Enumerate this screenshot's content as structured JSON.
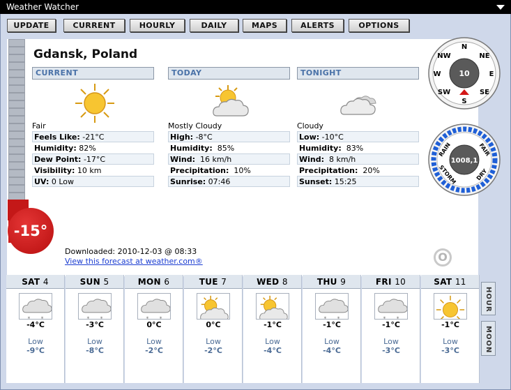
{
  "window": {
    "title": "Weather Watcher"
  },
  "toolbar": [
    {
      "id": "update",
      "label": "UPDATE"
    },
    {
      "id": "current",
      "label": "CURRENT"
    },
    {
      "id": "hourly",
      "label": "HOURLY"
    },
    {
      "id": "daily",
      "label": "DAILY"
    },
    {
      "id": "maps",
      "label": "MAPS"
    },
    {
      "id": "alerts",
      "label": "ALERTS"
    },
    {
      "id": "options",
      "label": "OPTIONS"
    }
  ],
  "location": "Gdansk, Poland",
  "current_temp": "-15°",
  "current": {
    "header": "CURRENT",
    "icon": "sun-icon",
    "condition": "Fair",
    "rows": [
      {
        "label": "Feels Like:",
        "value": " -21°C",
        "shaded": true
      },
      {
        "label": "Humidity:",
        "value": " 82%",
        "shaded": false
      },
      {
        "label": "Dew Point:",
        "value": " -17°C",
        "shaded": true
      },
      {
        "label": "Visibility:",
        "value": " 10 km",
        "shaded": false
      },
      {
        "label": "UV:",
        "value": " 0 Low",
        "shaded": true
      }
    ]
  },
  "today": {
    "header": "TODAY",
    "icon": "mostly-cloudy-icon",
    "condition": "Mostly Cloudy",
    "rows": [
      {
        "label": "High:",
        "value": " -8°C",
        "shaded": true
      },
      {
        "label": "Humidity:",
        "value": "  85%",
        "shaded": false
      },
      {
        "label": "Wind:",
        "value": "  16 km/h",
        "shaded": true
      },
      {
        "label": "Precipitation:",
        "value": "  10%",
        "shaded": false
      },
      {
        "label": "Sunrise:",
        "value": " 07:46",
        "shaded": true
      }
    ]
  },
  "tonight": {
    "header": "TONIGHT",
    "icon": "cloudy-icon",
    "condition": "Cloudy",
    "rows": [
      {
        "label": "Low:",
        "value": " -10°C",
        "shaded": true
      },
      {
        "label": "Humidity:",
        "value": "  83%",
        "shaded": false
      },
      {
        "label": "Wind:",
        "value": "  8 km/h",
        "shaded": true
      },
      {
        "label": "Precipitation:",
        "value": "  20%",
        "shaded": false
      },
      {
        "label": "Sunset:",
        "value": " 15:25",
        "shaded": true
      }
    ]
  },
  "downloaded": "Downloaded: 2010-12-03 @ 08:33",
  "forecast_link": "View this forecast at weather.com®",
  "compass": {
    "speed": "10",
    "labels": {
      "n": "N",
      "ne": "NE",
      "e": "E",
      "se": "SE",
      "s": "S",
      "sw": "SW",
      "w": "W",
      "nw": "NW"
    },
    "direction": "S"
  },
  "barometer": {
    "value": "1008,1",
    "labels": {
      "rain": "RAIN",
      "fair": "FAIR",
      "storm": "STORM",
      "dry": "DRY"
    }
  },
  "o_button": "O",
  "days": [
    {
      "name": "SAT",
      "date": "4",
      "icon": "snow-icon",
      "high": "-4°C",
      "low_label": "Low",
      "low": "-9°C"
    },
    {
      "name": "SUN",
      "date": "5",
      "icon": "snow-icon",
      "high": "-3°C",
      "low_label": "Low",
      "low": "-8°C"
    },
    {
      "name": "MON",
      "date": "6",
      "icon": "snow-icon",
      "high": "0°C",
      "low_label": "Low",
      "low": "-2°C"
    },
    {
      "name": "TUE",
      "date": "7",
      "icon": "partly-cloudy-icon",
      "high": "0°C",
      "low_label": "Low",
      "low": "-2°C"
    },
    {
      "name": "WED",
      "date": "8",
      "icon": "partly-cloudy-icon",
      "high": "-1°C",
      "low_label": "Low",
      "low": "-4°C"
    },
    {
      "name": "THU",
      "date": "9",
      "icon": "snow-icon",
      "high": "-1°C",
      "low_label": "Low",
      "low": "-4°C"
    },
    {
      "name": "FRI",
      "date": "10",
      "icon": "snow-icon",
      "high": "-1°C",
      "low_label": "Low",
      "low": "-3°C"
    },
    {
      "name": "SAT",
      "date": "11",
      "icon": "sunny-icon",
      "high": "-1°C",
      "low_label": "Low",
      "low": "-3°C"
    }
  ],
  "side_tabs": {
    "hour": "HOUR",
    "moon": "MOON"
  },
  "colors": {
    "accent": "#4a72a8",
    "temp": "#cc1f1f",
    "frame": "#cfd8ea"
  }
}
